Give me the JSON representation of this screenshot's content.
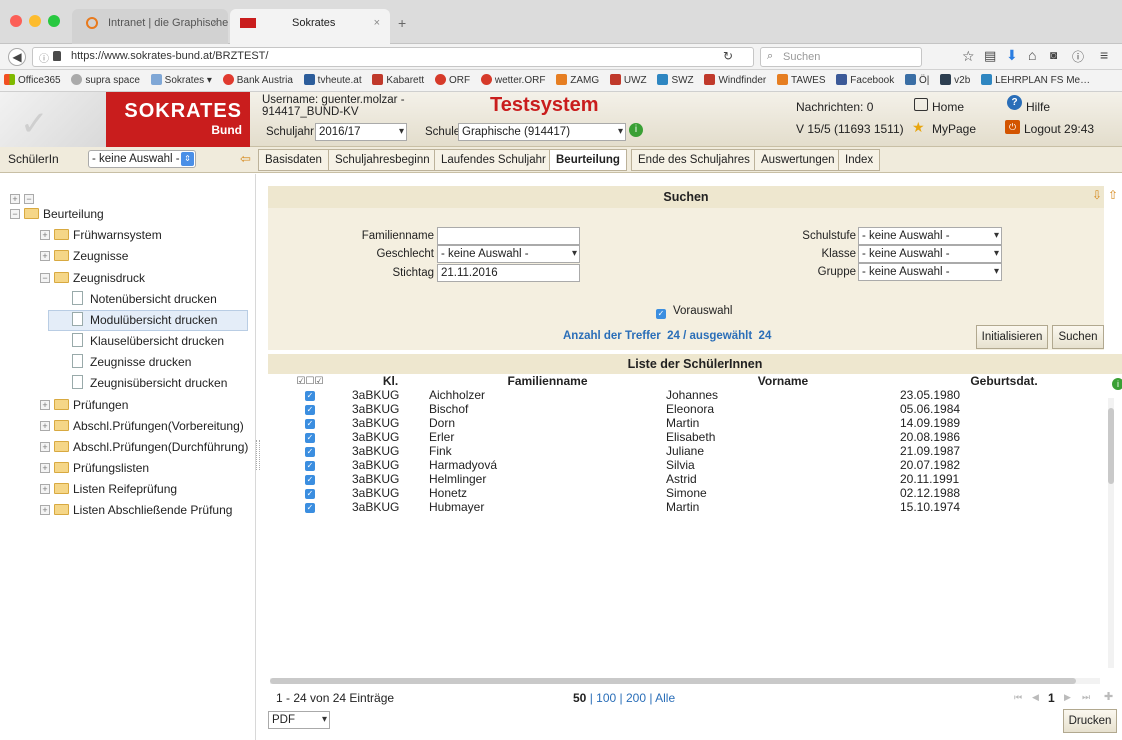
{
  "browser": {
    "tabs": [
      {
        "label": "Intranet | die Graphische"
      },
      {
        "label": "Sokrates"
      }
    ],
    "url": "https://www.sokrates-bund.at/BRZTEST/",
    "search_placeholder": "Suchen",
    "bookmarks": [
      "Office365",
      "supra space",
      "Sokrates",
      "Bank Austria",
      "tvheute.at",
      "Kabarett",
      "ORF",
      "wetter.ORF",
      "ZAMG",
      "UWZ",
      "SWZ",
      "Windfinder",
      "TAWES",
      "Facebook",
      "Ö|",
      "v2b",
      "LEHRPLAN FS Me…"
    ]
  },
  "header": {
    "logo_main": "SOKRATES",
    "logo_sub": "Bund",
    "username": "Username: guenter.molzar - 914417_BUND-KV",
    "schuljahr_label": "Schuljahr",
    "schuljahr_value": "2016/17",
    "schule_label": "Schule",
    "schule_value": "Graphische (914417)",
    "system": "Testsystem",
    "nachrichten": "Nachrichten: 0",
    "version": "V 15/5 (11693 1511)",
    "home": "Home",
    "hilfe": "Hilfe",
    "mypage": "MyPage",
    "logout": "Logout 29:43"
  },
  "schueler_select": {
    "label": "SchülerIn",
    "value": "- keine Auswahl -"
  },
  "nav_tabs": [
    "Basisdaten",
    "Schuljahresbeginn",
    "Laufendes Schuljahr",
    "Beurteilung",
    "Ende des Schuljahres",
    "Auswertungen",
    "Index"
  ],
  "tree": {
    "root": "Beurteilung",
    "items": [
      "Frühwarnsystem",
      "Zeugnisse",
      "Zeugnisdruck",
      "Notenübersicht drucken",
      "Modulübersicht drucken",
      "Klauselübersicht drucken",
      "Zeugnisse drucken",
      "Zeugnisübersicht drucken",
      "Prüfungen",
      "Abschl.Prüfungen(Vorbereitung)",
      "Abschl.Prüfungen(Durchführung)",
      "Prüfungslisten",
      "Listen Reifeprüfung",
      "Listen Abschließende Prüfung"
    ]
  },
  "search": {
    "title": "Suchen",
    "familienname_label": "Familienname",
    "familienname_value": "",
    "geschlecht_label": "Geschlecht",
    "geschlecht_value": "- keine Auswahl -",
    "stichtag_label": "Stichtag",
    "stichtag_value": "21.11.2016",
    "schulstufe_label": "Schulstufe",
    "schulstufe_value": "- keine Auswahl -",
    "klasse_label": "Klasse",
    "klasse_value": "- keine Auswahl -",
    "gruppe_label": "Gruppe",
    "gruppe_value": "- keine Auswahl -",
    "vorauswahl": "Vorauswahl",
    "treffer": "Anzahl der Treffer  24 / ausgewählt  24",
    "init_button": "Initialisieren",
    "search_button": "Suchen"
  },
  "list": {
    "title": "Liste der SchülerInnen",
    "select_header": "☑☐☑",
    "columns": [
      "Kl.",
      "Familienname",
      "Vorname",
      "Geburtsdat."
    ],
    "rows": [
      {
        "kl": "3aBKUG",
        "familienname": "Aichholzer",
        "vorname": "Johannes",
        "geburtsdat": "23.05.1980"
      },
      {
        "kl": "3aBKUG",
        "familienname": "Bischof",
        "vorname": "Eleonora",
        "geburtsdat": "05.06.1984"
      },
      {
        "kl": "3aBKUG",
        "familienname": "Dorn",
        "vorname": "Martin",
        "geburtsdat": "14.09.1989"
      },
      {
        "kl": "3aBKUG",
        "familienname": "Erler",
        "vorname": "Elisabeth",
        "geburtsdat": "20.08.1986"
      },
      {
        "kl": "3aBKUG",
        "familienname": "Fink",
        "vorname": "Juliane",
        "geburtsdat": "21.09.1987"
      },
      {
        "kl": "3aBKUG",
        "familienname": "Harmadyová",
        "vorname": "Silvia",
        "geburtsdat": "20.07.1982"
      },
      {
        "kl": "3aBKUG",
        "familienname": "Helmlinger",
        "vorname": "Astrid",
        "geburtsdat": "20.11.1991"
      },
      {
        "kl": "3aBKUG",
        "familienname": "Honetz",
        "vorname": "Simone",
        "geburtsdat": "02.12.1988"
      },
      {
        "kl": "3aBKUG",
        "familienname": "Hubmayer",
        "vorname": "Martin",
        "geburtsdat": "15.10.1974"
      }
    ],
    "pager_info": "1 - 24 von 24 Einträge",
    "page_sizes": [
      "50",
      "100",
      "200",
      "Alle"
    ],
    "current_page": "1",
    "format": "PDF",
    "print_button": "Drucken"
  },
  "colors": {
    "brand": "#c91d1d",
    "accent": "#2a6eb8",
    "panel": "#eee7cf"
  }
}
